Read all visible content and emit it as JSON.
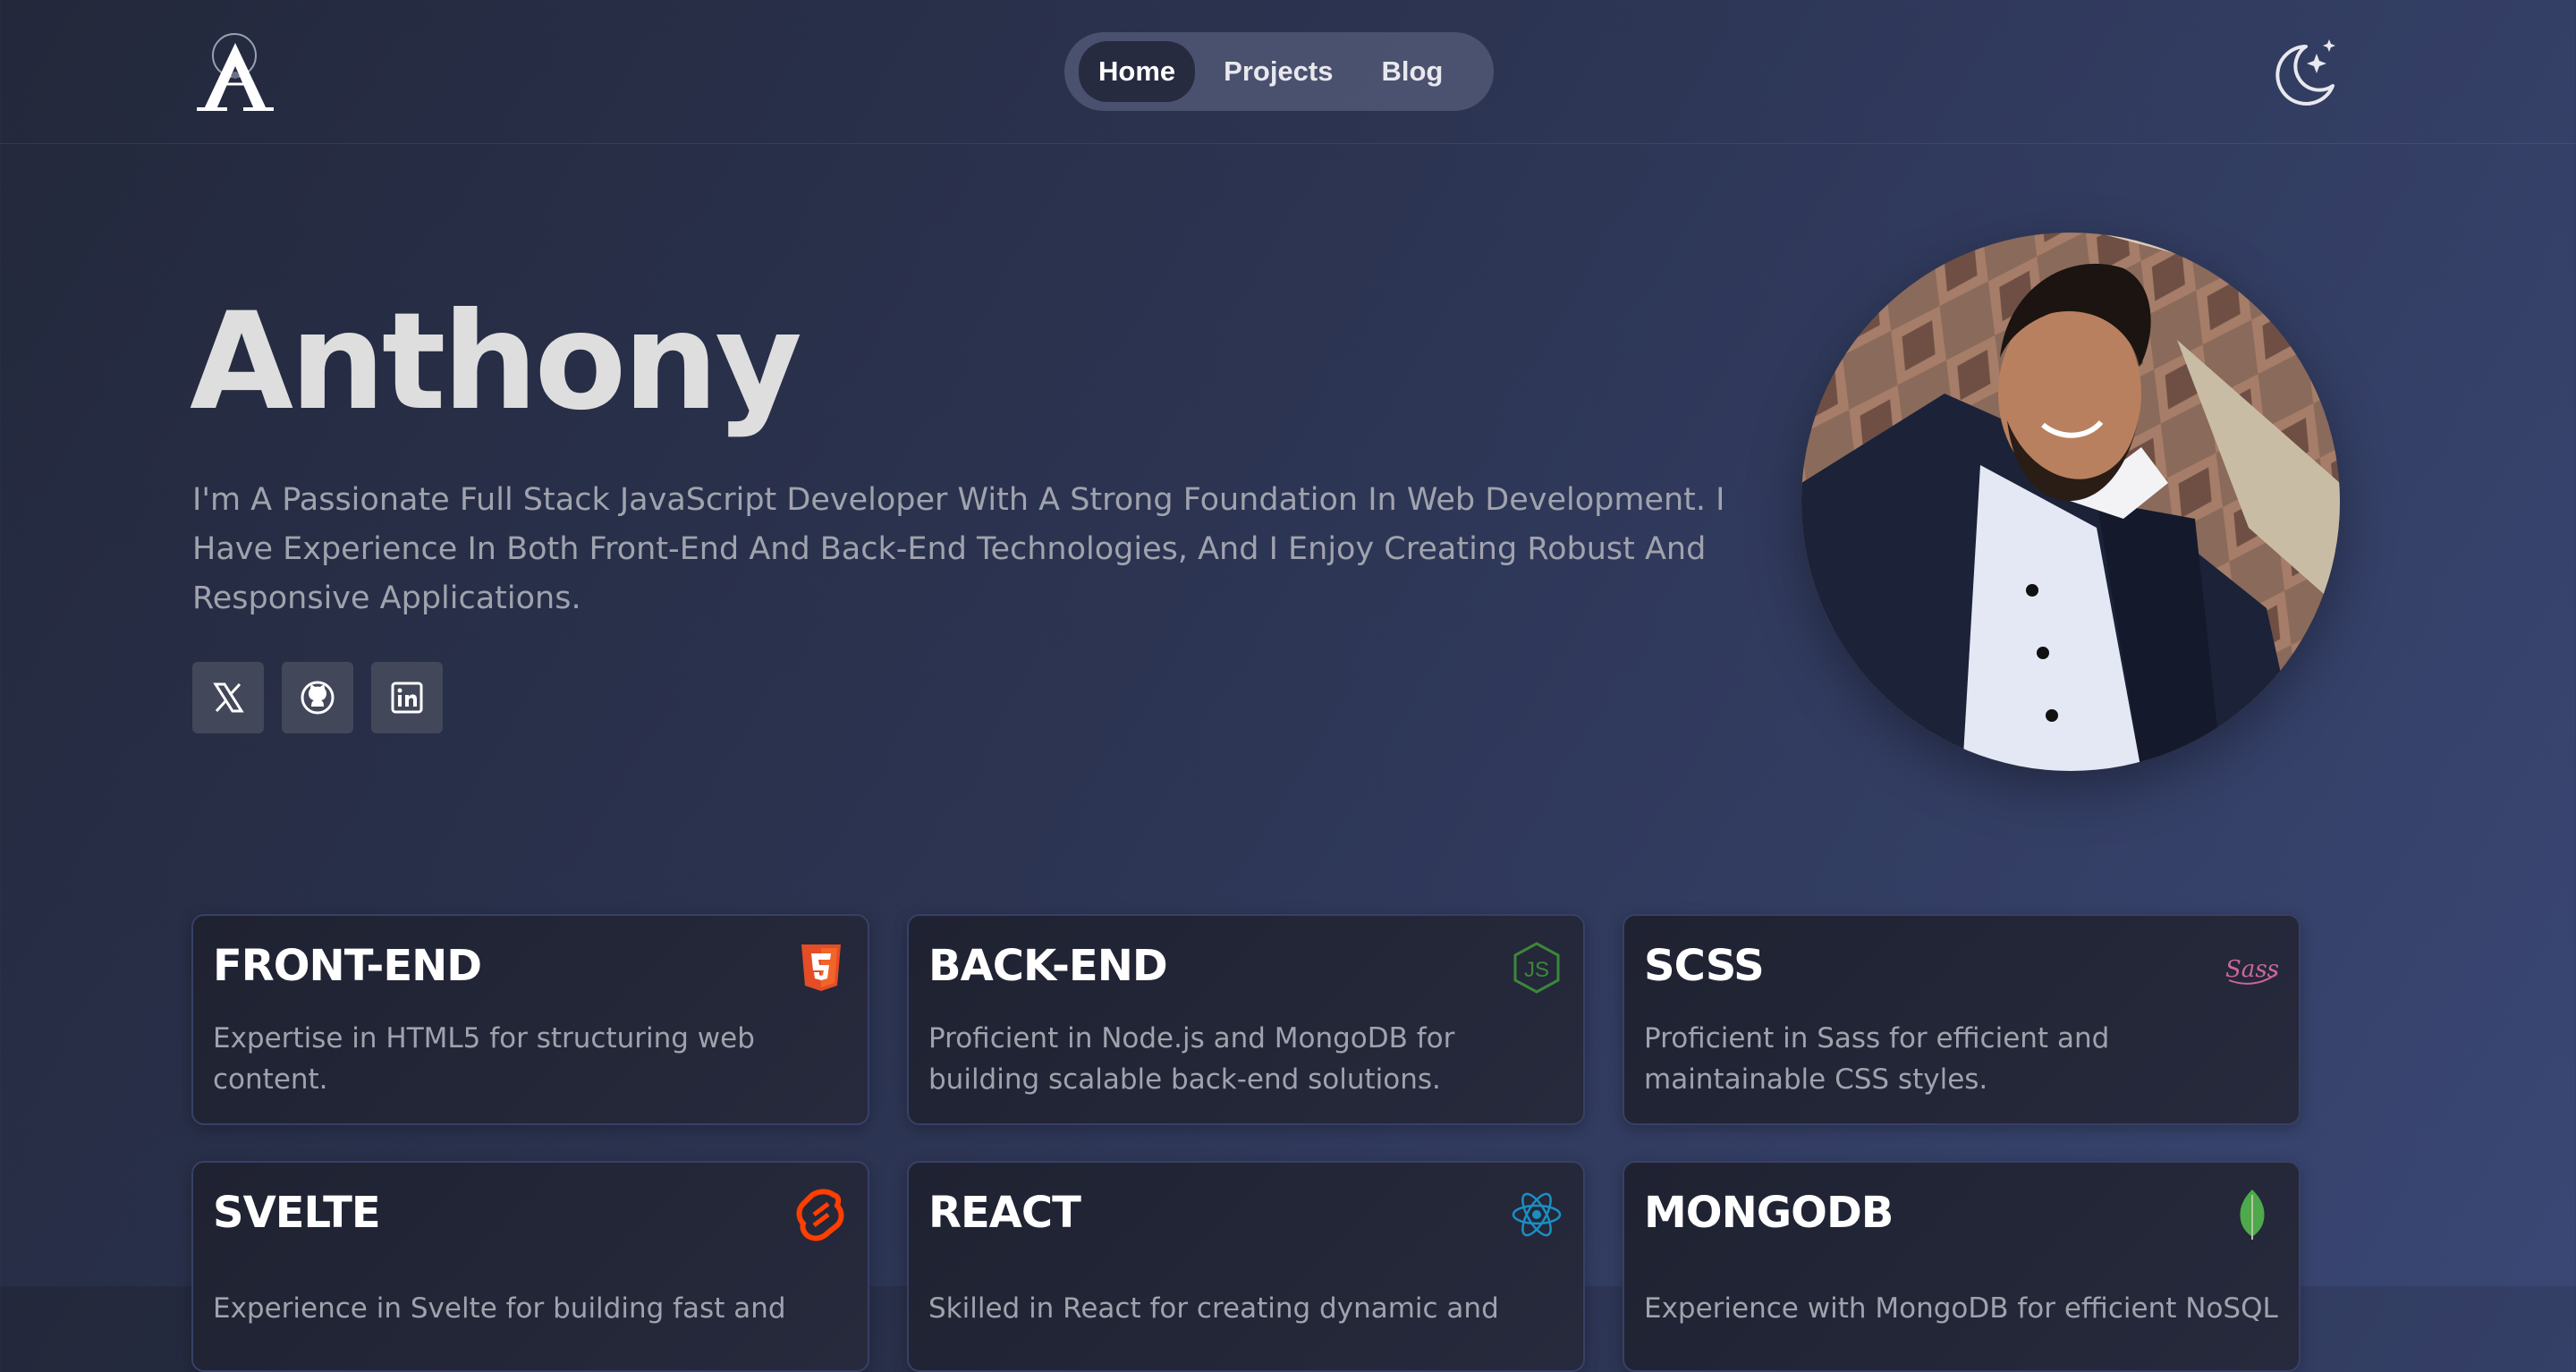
{
  "header": {
    "logo_letter": "A",
    "nav": [
      {
        "label": "Home",
        "active": true
      },
      {
        "label": "Projects",
        "active": false
      },
      {
        "label": "Blog",
        "active": false
      }
    ],
    "theme_icon": "moon-stars-icon"
  },
  "hero": {
    "name": "Anthony",
    "bio": "I'm A Passionate Full Stack JavaScript Developer With A Strong Foundation In Web Development. I Have Experience In Both Front-End And Back-End Technologies, And I Enjoy Creating Robust And Responsive Applications.",
    "socials": [
      {
        "icon": "x-twitter-icon"
      },
      {
        "icon": "github-icon"
      },
      {
        "icon": "linkedin-icon"
      }
    ]
  },
  "skills": [
    {
      "title": "FRONT-END",
      "icon": "html5-icon",
      "color": "#e44d26",
      "desc": "Expertise in HTML5 for structuring web content."
    },
    {
      "title": "BACK-END",
      "icon": "nodejs-icon",
      "color": "#3c873a",
      "desc": "Proficient in Node.js and MongoDB for building scalable back-end solutions."
    },
    {
      "title": "SCSS",
      "icon": "sass-icon",
      "color": "#cd6799",
      "desc": "Proficient in Sass for efficient and maintainable CSS styles."
    },
    {
      "title": "SVELTE",
      "icon": "svelte-icon",
      "color": "#ff3e00",
      "desc": "Experience in Svelte for building fast and"
    },
    {
      "title": "REACT",
      "icon": "react-icon",
      "color": "#1a8fc4",
      "desc": "Skilled in React for creating dynamic and"
    },
    {
      "title": "MONGODB",
      "icon": "mongodb-leaf-icon",
      "color": "#4da94b",
      "desc": "Experience with MongoDB for efficient NoSQL"
    }
  ]
}
